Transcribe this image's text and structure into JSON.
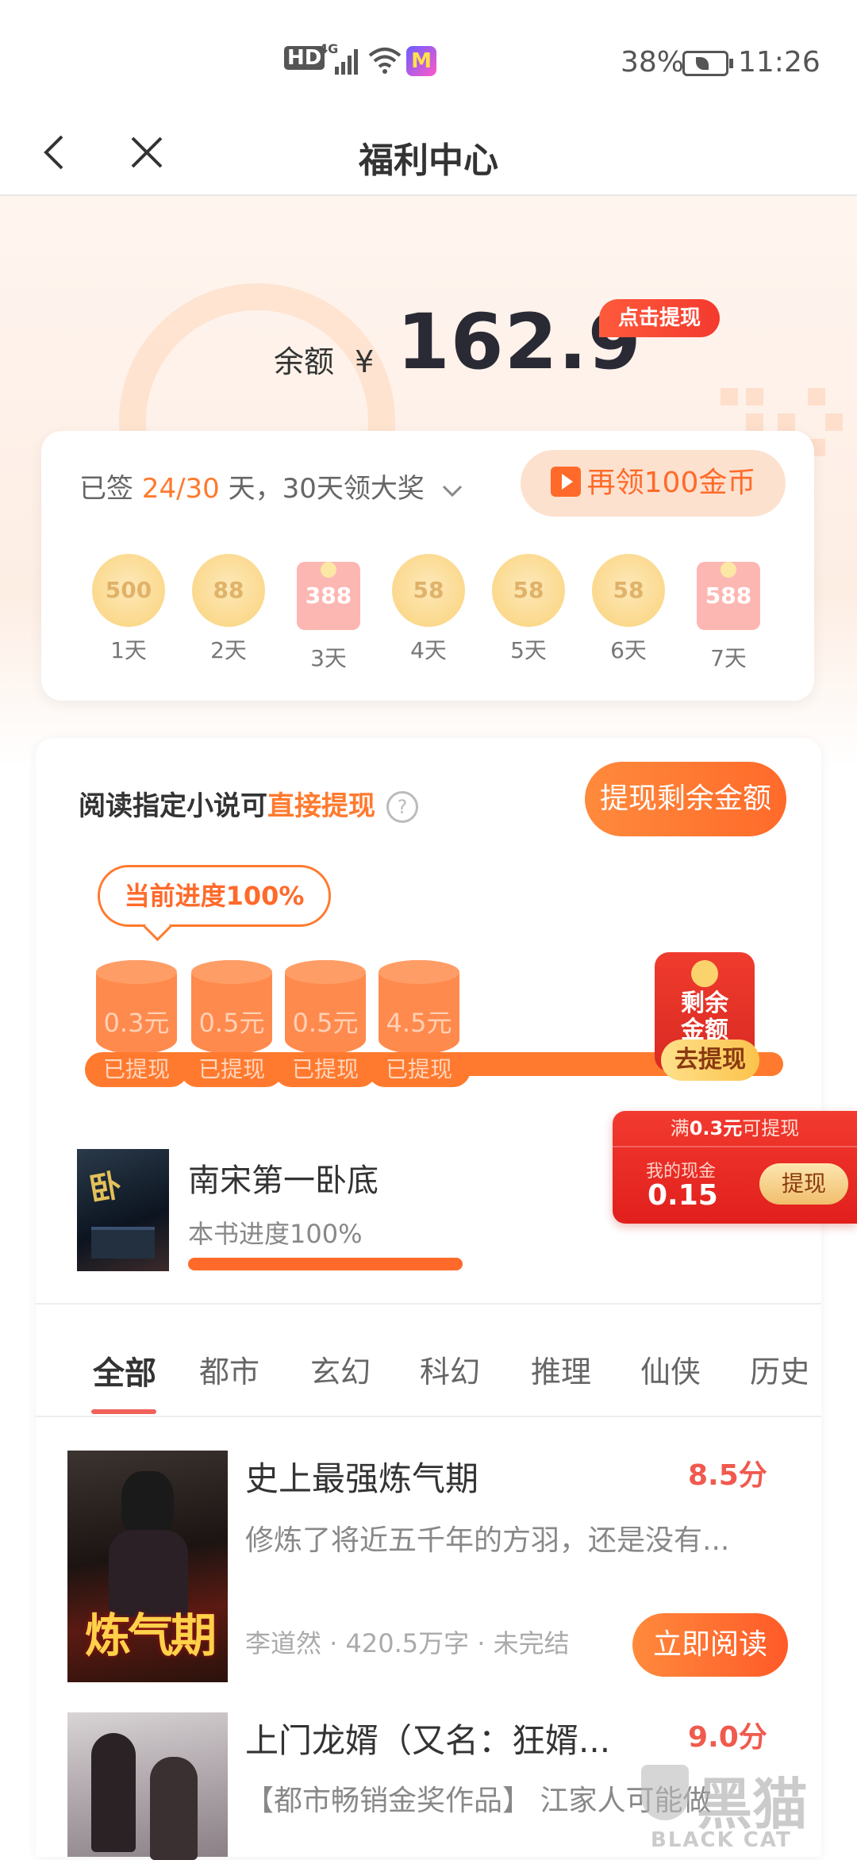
{
  "status_bar": {
    "network": "HD",
    "signal_type": "4G",
    "battery": "38%",
    "time": "11:26"
  },
  "header": {
    "title": "福利中心"
  },
  "balance": {
    "label": "余额",
    "currency": "¥",
    "value": "162.9",
    "badge": "点击提现"
  },
  "signin": {
    "text_prefix": "已签",
    "progress": "24/30",
    "text_suffix": "天，30天领大奖",
    "coin_button": "再领100金币",
    "days": [
      {
        "type": "coin",
        "value": "500",
        "label": "1天"
      },
      {
        "type": "coin",
        "value": "88",
        "label": "2天"
      },
      {
        "type": "redpack",
        "value": "388",
        "label": "3天"
      },
      {
        "type": "coin",
        "value": "58",
        "label": "4天"
      },
      {
        "type": "coin",
        "value": "58",
        "label": "5天"
      },
      {
        "type": "coin",
        "value": "58",
        "label": "6天"
      },
      {
        "type": "redpack",
        "value": "588",
        "label": "7天"
      }
    ]
  },
  "reading": {
    "title_prefix": "阅读指定小说可",
    "title_highlight": "直接提现",
    "help": "?",
    "withdraw_rest": "提现剩余金额",
    "progress_bubble": "当前进度100%",
    "stages": [
      {
        "amount": "0.3元",
        "status": "已提现"
      },
      {
        "amount": "0.5元",
        "status": "已提现"
      },
      {
        "amount": "0.5元",
        "status": "已提现"
      },
      {
        "amount": "4.5元",
        "status": "已提现"
      }
    ],
    "final": {
      "line1": "剩余",
      "line2": "金额",
      "action": "去提现"
    },
    "book": {
      "title": "南宋第一卧底",
      "progress_label": "本书进度100%",
      "progress": 1.0
    }
  },
  "cash_widget": {
    "header_prefix": "满",
    "header_amount": "0.3元",
    "header_suffix": "可提现",
    "label": "我的现金",
    "value": "0.15",
    "button": "提现"
  },
  "tabs": [
    "全部",
    "都市",
    "玄幻",
    "科幻",
    "推理",
    "仙侠",
    "历史"
  ],
  "books": [
    {
      "title": "史上最强炼气期",
      "score": "8.5分",
      "desc": "修炼了将近五千年的方羽，还是没有...",
      "meta": "李道然 · 420.5万字 · 未完结",
      "action": "立即阅读"
    },
    {
      "title": "上门龙婿（又名：狂婿...",
      "score": "9.0分",
      "desc": "【都市畅销金奖作品】 江家人可能做"
    }
  ],
  "watermark": {
    "text": "黑猫",
    "sub": "BLACK CAT"
  },
  "colors": {
    "accent": "#ff6a2a",
    "red": "#e11f1c",
    "score": "#f05a4e"
  }
}
